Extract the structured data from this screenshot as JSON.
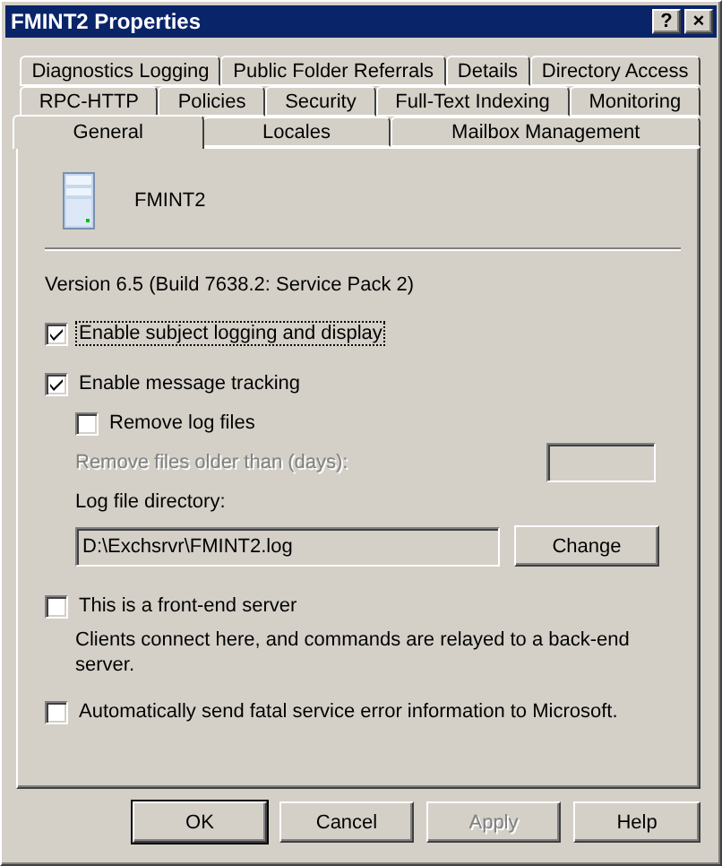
{
  "window": {
    "title": "FMINT2 Properties",
    "buttons": [
      "?",
      "×"
    ]
  },
  "tab_rows": [
    [
      {
        "label": "Diagnostics Logging",
        "selected": false
      },
      {
        "label": "Public Folder Referrals",
        "selected": false
      },
      {
        "label": "Details",
        "selected": false
      },
      {
        "label": "Directory Access",
        "selected": false
      }
    ],
    [
      {
        "label": "RPC-HTTP",
        "selected": false
      },
      {
        "label": "Policies",
        "selected": false
      },
      {
        "label": "Security",
        "selected": false
      },
      {
        "label": "Full-Text Indexing",
        "selected": false
      },
      {
        "label": "Monitoring",
        "selected": false
      }
    ],
    [
      {
        "label": "General",
        "selected": true
      },
      {
        "label": "Locales",
        "selected": false
      },
      {
        "label": "Mailbox Management",
        "selected": false
      }
    ]
  ],
  "server": {
    "name": "FMINT2"
  },
  "version": "Version 6.5 (Build 7638.2: Service Pack 2)",
  "subject_logging": {
    "label": "Enable subject logging and display",
    "checked": true,
    "focused": true
  },
  "message_tracking": {
    "label": "Enable message tracking",
    "checked": true,
    "focused": false
  },
  "remove_log_files": {
    "label": "Remove log files",
    "checked": false,
    "focused": false
  },
  "remove_older": {
    "label": "Remove files older than (days):",
    "disabled": true
  },
  "log_directory": {
    "label": "Log file directory:",
    "value": "D:\\Exchsrvr\\FMINT2.log",
    "button": "Change"
  },
  "front_end": {
    "label": "This is a front-end server",
    "checked": false,
    "focused": false,
    "description": "Clients connect here, and commands are relayed to a back-end server."
  },
  "error_reporting": {
    "label": "Automatically send fatal service error information to Microsoft.",
    "checked": false,
    "focused": false
  },
  "buttons": [
    {
      "label": "OK",
      "default": true,
      "disabled": false
    },
    {
      "label": "Cancel",
      "default": false,
      "disabled": false
    },
    {
      "label": "Apply",
      "default": false,
      "disabled": true
    },
    {
      "label": "Help",
      "default": false,
      "disabled": false
    }
  ]
}
